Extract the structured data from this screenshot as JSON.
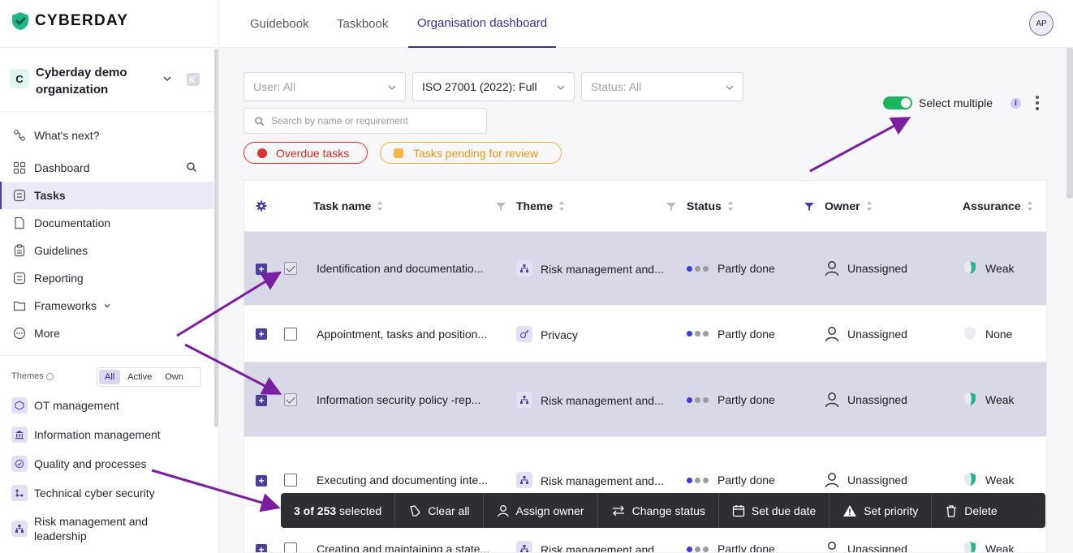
{
  "brand": {
    "name": "CYBERDAY"
  },
  "org": {
    "initial": "C",
    "name": "Cyberday demo organization"
  },
  "nav": {
    "whats_next": "What's next?",
    "dashboard": "Dashboard",
    "tasks": "Tasks",
    "documentation": "Documentation",
    "guidelines": "Guidelines",
    "reporting": "Reporting",
    "frameworks": "Frameworks",
    "more": "More"
  },
  "themes": {
    "label": "Themes",
    "filters": [
      "All",
      "Active",
      "Own"
    ],
    "active_filter": "All",
    "items": [
      "OT management",
      "Information management",
      "Quality and processes",
      "Technical cyber security",
      "Risk management and leadership"
    ]
  },
  "topnav": {
    "tabs": [
      "Guidebook",
      "Taskbook",
      "Organisation dashboard"
    ],
    "active_tab": "Organisation dashboard",
    "user_initials": "AP"
  },
  "filters": {
    "user": "User: All",
    "framework": "ISO 27001 (2022): Full",
    "status": "Status: All",
    "search_placeholder": "Search by name or requirement",
    "overdue": "Overdue tasks",
    "pending": "Tasks pending for review"
  },
  "select_multiple": {
    "label": "Select multiple",
    "enabled": true
  },
  "table": {
    "columns": [
      "Task name",
      "Theme",
      "Status",
      "Owner",
      "Assurance"
    ],
    "rows": [
      {
        "name": "Identification and documentatio...",
        "theme": "Risk management and...",
        "status": "Partly done",
        "owner": "Unassigned",
        "assurance": "Weak",
        "selected": true
      },
      {
        "name": "Appointment, tasks and position...",
        "theme": "Privacy",
        "status": "Partly done",
        "owner": "Unassigned",
        "assurance": "None",
        "selected": false
      },
      {
        "name": "Information security policy -rep...",
        "theme": "Risk management and...",
        "status": "Partly done",
        "owner": "Unassigned",
        "assurance": "Weak",
        "selected": true
      },
      {
        "name": "Executing and documenting inte...",
        "theme": "Risk management and...",
        "status": "Partly done",
        "owner": "Unassigned",
        "assurance": "Weak",
        "selected": false
      },
      {
        "name": "Creating and maintaining a state...",
        "theme": "Risk management and...",
        "status": "Partly done",
        "owner": "Unassigned",
        "assurance": "Weak",
        "selected": false
      }
    ]
  },
  "actionbar": {
    "count_text": "3 of 253",
    "selected_text": "selected",
    "clear_all": "Clear all",
    "assign_owner": "Assign owner",
    "change_status": "Change status",
    "set_due_date": "Set due date",
    "set_priority": "Set priority",
    "delete": "Delete"
  },
  "colors": {
    "brand": "#3d2f8f",
    "toggle_on": "#1cb55d",
    "overdue": "#e03131",
    "pending": "#f0a020",
    "annotation_arrow": "#7a1fa2"
  }
}
